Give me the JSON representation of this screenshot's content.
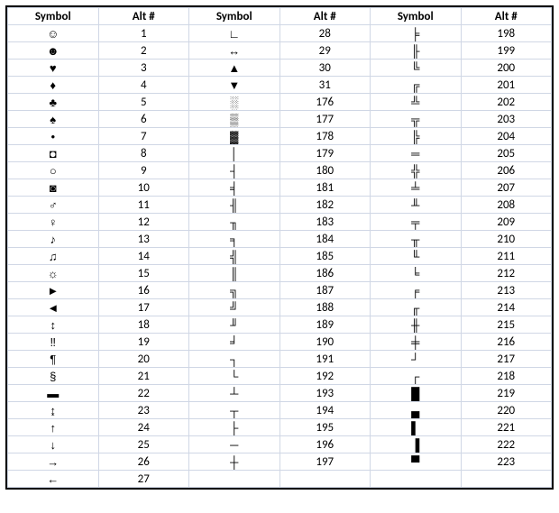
{
  "chart_data": {
    "type": "table",
    "title": "Alt Code Symbol Table",
    "columns": [
      "Symbol",
      "Alt #",
      "Symbol",
      "Alt #",
      "Symbol",
      "Alt #"
    ],
    "rows": [
      [
        "☺",
        "1",
        "∟",
        "28",
        "╞",
        "198"
      ],
      [
        "☻",
        "2",
        "↔",
        "29",
        "╟",
        "199"
      ],
      [
        "♥",
        "3",
        "▲",
        "30",
        "╚",
        "200"
      ],
      [
        "♦",
        "4",
        "▼",
        "31",
        "╔",
        "201"
      ],
      [
        "♣",
        "5",
        "░",
        "176",
        "╩",
        "202"
      ],
      [
        "♠",
        "6",
        "▒",
        "177",
        "╦",
        "203"
      ],
      [
        "•",
        "7",
        "▓",
        "178",
        "╠",
        "204"
      ],
      [
        "◘",
        "8",
        "│",
        "179",
        "═",
        "205"
      ],
      [
        "○",
        "9",
        "┤",
        "180",
        "╬",
        "206"
      ],
      [
        "◙",
        "10",
        "╡",
        "181",
        "╧",
        "207"
      ],
      [
        "♂",
        "11",
        "╢",
        "182",
        "╨",
        "208"
      ],
      [
        "♀",
        "12",
        "╖",
        "183",
        "╤",
        "209"
      ],
      [
        "♪",
        "13",
        "╕",
        "184",
        "╥",
        "210"
      ],
      [
        "♫",
        "14",
        "╣",
        "185",
        "╙",
        "211"
      ],
      [
        "☼",
        "15",
        "║",
        "186",
        "╘",
        "212"
      ],
      [
        "►",
        "16",
        "╗",
        "187",
        "╒",
        "213"
      ],
      [
        "◄",
        "17",
        "╝",
        "188",
        "╓",
        "214"
      ],
      [
        "↕",
        "18",
        "╜",
        "189",
        "╫",
        "215"
      ],
      [
        "‼",
        "19",
        "╛",
        "190",
        "╪",
        "216"
      ],
      [
        "¶",
        "20",
        "┐",
        "191",
        "┘",
        "217"
      ],
      [
        "§",
        "21",
        "└",
        "192",
        "┌",
        "218"
      ],
      [
        "▬",
        "22",
        "┴",
        "193",
        "█",
        "219"
      ],
      [
        "↨",
        "23",
        "┬",
        "194",
        "▄",
        "220"
      ],
      [
        "↑",
        "24",
        "├",
        "195",
        "▌",
        "221"
      ],
      [
        "↓",
        "25",
        "─",
        "196",
        "▐",
        "222"
      ],
      [
        "→",
        "26",
        "┼",
        "197",
        "▀",
        "223"
      ],
      [
        "←",
        "27",
        "",
        "",
        "",
        ""
      ]
    ]
  },
  "headers": {
    "sym": "Symbol",
    "alt": "Alt #"
  }
}
